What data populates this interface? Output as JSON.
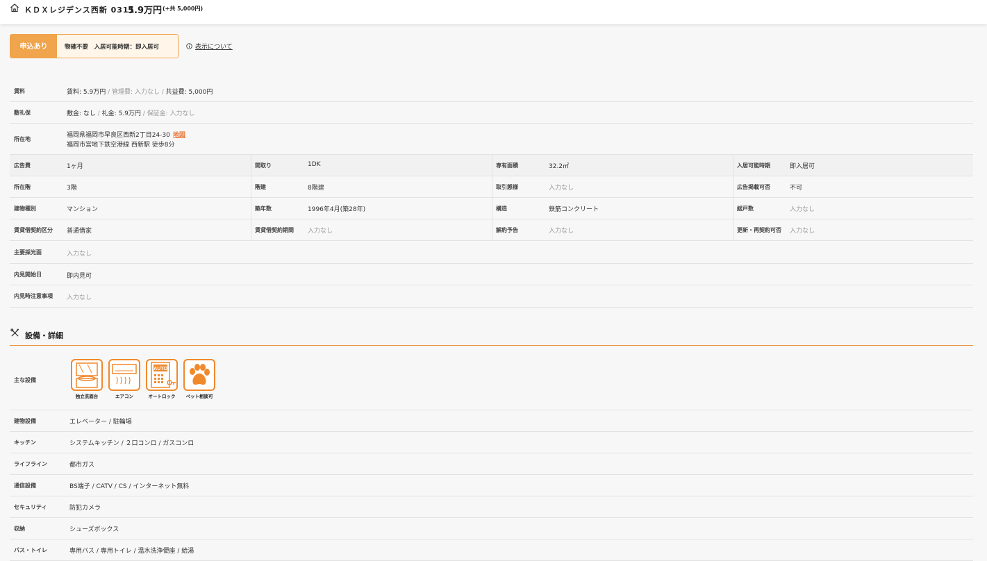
{
  "header": {
    "name": "ＫＤＸレジデンス西新 0311",
    "price": "5.9万円",
    "kyoeki": "(+共 5,000円)"
  },
  "status": {
    "badge": "申込あり",
    "description": "物確不要　入居可能時期：即入居可",
    "about_link": "表示について"
  },
  "summary": {
    "rent": {
      "label": "賃料",
      "rent": "賃料: 5.9万円",
      "mgmt": "管理費: 入力なし",
      "common": "共益費: 5,000円"
    },
    "deposit": {
      "label": "敷礼保",
      "shiki": "敷金: なし",
      "rei": "礼金: 5.9万円",
      "hosho": "保証金: 入力なし"
    },
    "location": {
      "label": "所在地",
      "address": "福岡県福岡市早良区西新2丁目24-30",
      "map_link": "地図",
      "access": "福岡市営地下鉄空港線 西新駅 徒歩8分"
    }
  },
  "grid": [
    [
      {
        "label": "広告費",
        "value": "1ヶ月",
        "muted": false
      },
      {
        "label": "間取り",
        "value": "1DK",
        "muted": false
      },
      {
        "label": "専有面積",
        "value": "32.2㎡",
        "muted": false
      },
      {
        "label": "入居可能時期",
        "value": "即入居可",
        "muted": false
      }
    ],
    [
      {
        "label": "所在階",
        "value": "3階",
        "muted": false
      },
      {
        "label": "階建",
        "value": "8階建",
        "muted": false
      },
      {
        "label": "取引態様",
        "value": "入力なし",
        "muted": true
      },
      {
        "label": "広告掲載可否",
        "value": "不可",
        "muted": false
      }
    ],
    [
      {
        "label": "建物種別",
        "value": "マンション",
        "muted": false
      },
      {
        "label": "築年数",
        "value": "1996年4月(築28年)",
        "muted": false
      },
      {
        "label": "構造",
        "value": "鉄筋コンクリート",
        "muted": false
      },
      {
        "label": "総戸数",
        "value": "入力なし",
        "muted": true
      }
    ],
    [
      {
        "label": "賃貸借契約区分",
        "value": "普通借家",
        "muted": false
      },
      {
        "label": "賃貸借契約期間",
        "value": "入力なし",
        "muted": true
      },
      {
        "label": "解約予告",
        "value": "入力なし",
        "muted": true
      },
      {
        "label": "更新・再契約可否",
        "value": "入力なし",
        "muted": true
      }
    ]
  ],
  "extra": [
    {
      "label": "主要採光面",
      "value": "入力なし",
      "muted": true
    },
    {
      "label": "内見開始日",
      "value": "即内見可",
      "muted": false
    },
    {
      "label": "内見時注意事項",
      "value": "入力なし",
      "muted": true
    }
  ],
  "equipment": {
    "title": "設備・詳細",
    "main_label": "主な設備",
    "icons": [
      {
        "label": "独立洗面台",
        "icon": "vanity-icon"
      },
      {
        "label": "エアコン",
        "icon": "air-conditioner-icon"
      },
      {
        "label": "オートロック",
        "icon": "auto-lock-icon",
        "icon_text": "AUTO"
      },
      {
        "label": "ペット相談可",
        "icon": "pet-paw-icon"
      }
    ],
    "rows": [
      {
        "label": "建物設備",
        "value": "エレベーター / 駐輪場"
      },
      {
        "label": "キッチン",
        "value": "システムキッチン / ２口コンロ / ガスコンロ"
      },
      {
        "label": "ライフライン",
        "value": "都市ガス"
      },
      {
        "label": "通信設備",
        "value": "BS端子 / CATV / CS / インターネット無料"
      },
      {
        "label": "セキュリティ",
        "value": "防犯カメラ"
      },
      {
        "label": "収納",
        "value": "シューズボックス"
      },
      {
        "label": "バス・トイレ",
        "value": "専用バス / 専用トイレ / 温水洗浄便座 / 給湯"
      }
    ]
  },
  "colors": {
    "accent": "#f0a44c",
    "accent_dark": "#e8923f",
    "link": "#e8773a"
  }
}
